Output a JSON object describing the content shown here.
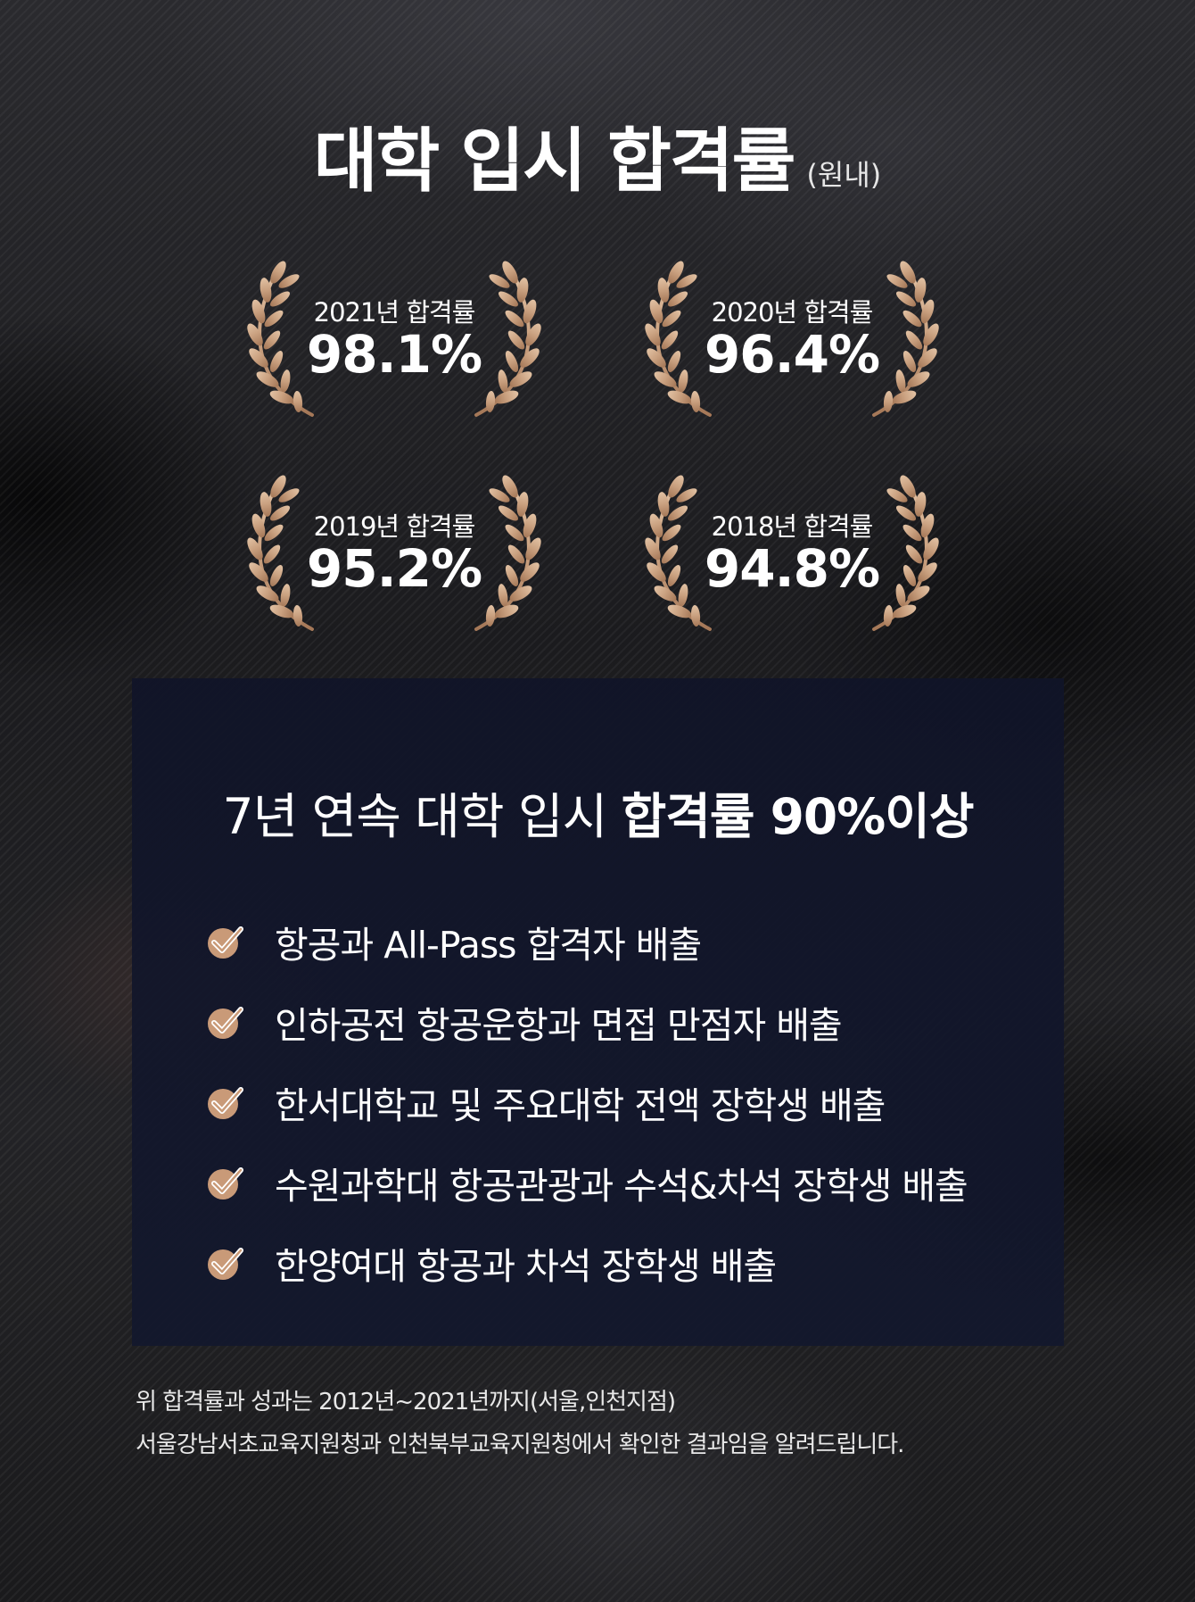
{
  "header": {
    "title": "대학 입시 합격률",
    "note": "(원내)"
  },
  "awards": [
    {
      "year_label": "2021년 합격률",
      "rate": "98.1%"
    },
    {
      "year_label": "2020년 합격률",
      "rate": "96.4%"
    },
    {
      "year_label": "2019년 합격률",
      "rate": "95.2%"
    },
    {
      "year_label": "2018년 합격률",
      "rate": "94.8%"
    }
  ],
  "panel": {
    "heading_normal": "7년 연속 대학 입시",
    "heading_strong": "합격률 90%이상",
    "items": [
      "항공과 All-Pass 합격자 배출",
      "인하공전 항공운항과 면접 만점자 배출",
      "한서대학교 및 주요대학 전액 장학생 배출",
      "수원과학대 항공관광과 수석&차석 장학생 배출",
      "한양여대 항공과 차석 장학생 배출"
    ]
  },
  "footnote": {
    "line1": "위 합격률과 성과는 2012년~2021년까지(서울,인천지점)",
    "line2": "서울강남서초교육지원청과 인천북부교육지원청에서 확인한 결과임을 알려드립니다."
  },
  "colors": {
    "laurel_gold": "#c9a07f",
    "check_circle": "#c99a78",
    "panel_bg": "#12172d",
    "text": "#ffffff"
  },
  "icons": {
    "award": "laurel-wreath-icon",
    "bullet": "check-circle-icon"
  }
}
